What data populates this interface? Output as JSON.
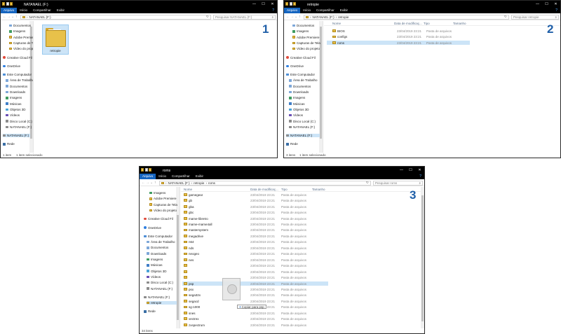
{
  "common": {
    "ribbon_tabs": [
      "Arquivo",
      "Início",
      "Compartilhar",
      "Exibir"
    ],
    "caption_min": "—",
    "caption_max": "☐",
    "caption_close": "✕",
    "help": "?"
  },
  "win1": {
    "title": "NATANAEL (F:)",
    "path": [
      "NATANAEL (F:)"
    ],
    "search_placeholder": "Pesquisar NATANAEL (F:)",
    "nav": [
      {
        "label": "Documentos",
        "icon": "doc"
      },
      {
        "label": "Imagens",
        "icon": "img"
      },
      {
        "label": "Adobe Premiere",
        "icon": "folder"
      },
      {
        "label": "Capturas de Tela",
        "icon": "folder"
      },
      {
        "label": "Vídeo do projeto",
        "icon": "folder"
      },
      {
        "label": "Creative Cloud Fil",
        "icon": "cc"
      },
      {
        "label": "OneDrive",
        "icon": "one"
      },
      {
        "label": "Este Computador",
        "icon": "pc"
      },
      {
        "label": "Área de Trabalho",
        "icon": "doc"
      },
      {
        "label": "Documentos",
        "icon": "doc"
      },
      {
        "label": "Downloads",
        "icon": "doc"
      },
      {
        "label": "Imagens",
        "icon": "img"
      },
      {
        "label": "Músicas",
        "icon": "music"
      },
      {
        "label": "Objetos 3D",
        "icon": "obj"
      },
      {
        "label": "Vídeos",
        "icon": "video"
      },
      {
        "label": "Disco Local (C:)",
        "icon": "drive"
      },
      {
        "label": "NATANAEL (F:)",
        "icon": "drive"
      },
      {
        "label": "NATANAEL (F:)",
        "icon": "drive",
        "selected": true
      },
      {
        "label": "Rede",
        "icon": "net"
      }
    ],
    "folder_label": "retropie",
    "status_count": "1 item",
    "status_selected": "1 item selecionado",
    "number": "1"
  },
  "win2": {
    "title": "retropie",
    "path": [
      "NATANAEL (F:)",
      "retropie"
    ],
    "search_placeholder": "Pesquisar retropie",
    "columns": {
      "name": "Nome",
      "date": "Data de modificaç...",
      "type": "Tipo",
      "size": "Tamanho"
    },
    "rows": [
      {
        "name": "BIOS",
        "date": "23/04/2019 23:21",
        "type": "Pasta de arquivos"
      },
      {
        "name": "configs",
        "date": "23/04/2019 23:21",
        "type": "Pasta de arquivos"
      },
      {
        "name": "roms",
        "date": "23/04/2019 23:21",
        "type": "Pasta de arquivos",
        "selected": true
      }
    ],
    "nav": [
      {
        "label": "Documentos",
        "icon": "doc"
      },
      {
        "label": "Imagens",
        "icon": "img"
      },
      {
        "label": "Adobe Premiere",
        "icon": "folder"
      },
      {
        "label": "Capturas de Tela",
        "icon": "folder"
      },
      {
        "label": "Vídeo do projeto",
        "icon": "folder"
      },
      {
        "label": "Creative Cloud Fil",
        "icon": "cc"
      },
      {
        "label": "OneDrive",
        "icon": "one"
      },
      {
        "label": "Este Computador",
        "icon": "pc"
      },
      {
        "label": "Área de Trabalho",
        "icon": "doc"
      },
      {
        "label": "Documentos",
        "icon": "doc"
      },
      {
        "label": "Downloads",
        "icon": "doc"
      },
      {
        "label": "Imagens",
        "icon": "img"
      },
      {
        "label": "Músicas",
        "icon": "music"
      },
      {
        "label": "Objetos 3D",
        "icon": "obj"
      },
      {
        "label": "Vídeos",
        "icon": "video"
      },
      {
        "label": "Disco Local (C:)",
        "icon": "drive"
      },
      {
        "label": "NATANAEL (F:)",
        "icon": "drive"
      },
      {
        "label": "NATANAEL (F:)",
        "icon": "drive",
        "selected": true
      },
      {
        "label": "Rede",
        "icon": "net"
      }
    ],
    "status_count": "3 itens",
    "status_selected": "1 item selecionado",
    "number": "2"
  },
  "win3": {
    "title": "roms",
    "path": [
      "NATANAEL (F:)",
      "retropie",
      "roms"
    ],
    "search_placeholder": "Pesquisar roms",
    "columns": {
      "name": "Nome",
      "date": "Data de modificaç...",
      "type": "Tipo",
      "size": "Tamanho"
    },
    "rows": [
      {
        "name": "gamegear",
        "date": "23/04/2019 23:21",
        "type": "Pasta de arquivos"
      },
      {
        "name": "gb",
        "date": "23/04/2019 23:21",
        "type": "Pasta de arquivos"
      },
      {
        "name": "gba",
        "date": "23/04/2019 23:21",
        "type": "Pasta de arquivos"
      },
      {
        "name": "gbc",
        "date": "23/04/2019 23:21",
        "type": "Pasta de arquivos"
      },
      {
        "name": "mame-libretro",
        "date": "23/04/2019 23:21",
        "type": "Pasta de arquivos"
      },
      {
        "name": "mame-mame4all",
        "date": "23/04/2019 23:21",
        "type": "Pasta de arquivos"
      },
      {
        "name": "mastersystem",
        "date": "23/04/2019 23:21",
        "type": "Pasta de arquivos"
      },
      {
        "name": "megadrive",
        "date": "23/04/2019 23:21",
        "type": "Pasta de arquivos"
      },
      {
        "name": "n64",
        "date": "23/04/2019 23:21",
        "type": "Pasta de arquivos"
      },
      {
        "name": "nds",
        "date": "23/04/2019 23:21",
        "type": "Pasta de arquivos"
      },
      {
        "name": "neogeo",
        "date": "23/04/2019 23:21",
        "type": "Pasta de arquivos"
      },
      {
        "name": "nes",
        "date": "23/04/2019 23:21",
        "type": "Pasta de arquivos"
      },
      {
        "name": "",
        "date": "23/04/2019 23:21",
        "type": "Pasta de arquivos"
      },
      {
        "name": "",
        "date": "23/04/2019 23:21",
        "type": "Pasta de arquivos"
      },
      {
        "name": "",
        "date": "23/04/2019 23:21",
        "type": "Pasta de arquivos"
      },
      {
        "name": "psp",
        "date": "23/04/2019 23:21",
        "type": "Pasta de arquivos",
        "selected": true
      },
      {
        "name": "psx",
        "date": "23/04/2019 23:21",
        "type": "Pasta de arquivos"
      },
      {
        "name": "sega32x",
        "date": "23/04/2019 23:21",
        "type": "Pasta de arquivos"
      },
      {
        "name": "segacd",
        "date": "23/04/2019 23:21",
        "type": "Pasta de arquivos"
      },
      {
        "name": "sg-1000",
        "date": "23/04/2019 23:21",
        "type": "Pasta de arquivos"
      },
      {
        "name": "snes",
        "date": "23/04/2019 23:21",
        "type": "Pasta de arquivos"
      },
      {
        "name": "vectrex",
        "date": "23/04/2019 23:21",
        "type": "Pasta de arquivos"
      },
      {
        "name": "zxspectrum",
        "date": "23/04/2019 23:21",
        "type": "Pasta de arquivos"
      }
    ],
    "nav": [
      {
        "label": "Imagens",
        "icon": "img"
      },
      {
        "label": "Adobe Premiere",
        "icon": "folder"
      },
      {
        "label": "Capturas de Tela",
        "icon": "folder"
      },
      {
        "label": "Vídeo do projeto",
        "icon": "folder"
      },
      {
        "label": "Creative Cloud Fil",
        "icon": "cc"
      },
      {
        "label": "OneDrive",
        "icon": "one"
      },
      {
        "label": "Este Computador",
        "icon": "pc"
      },
      {
        "label": "Área de Trabalho",
        "icon": "doc"
      },
      {
        "label": "Documentos",
        "icon": "doc"
      },
      {
        "label": "Downloads",
        "icon": "doc"
      },
      {
        "label": "Imagens",
        "icon": "img"
      },
      {
        "label": "Músicas",
        "icon": "music"
      },
      {
        "label": "Objetos 3D",
        "icon": "obj"
      },
      {
        "label": "Vídeos",
        "icon": "video"
      },
      {
        "label": "Disco Local (C:)",
        "icon": "drive"
      },
      {
        "label": "NATANAEL (F:)",
        "icon": "drive"
      },
      {
        "label": "NATANAEL (F:)",
        "icon": "drive"
      },
      {
        "label": "retropie",
        "icon": "folder",
        "selected": true
      },
      {
        "label": "Rede",
        "icon": "net"
      }
    ],
    "drag_tooltip": "Copiar para psp",
    "drag_plus": "+",
    "status_count": "34 itens",
    "number": "3"
  }
}
